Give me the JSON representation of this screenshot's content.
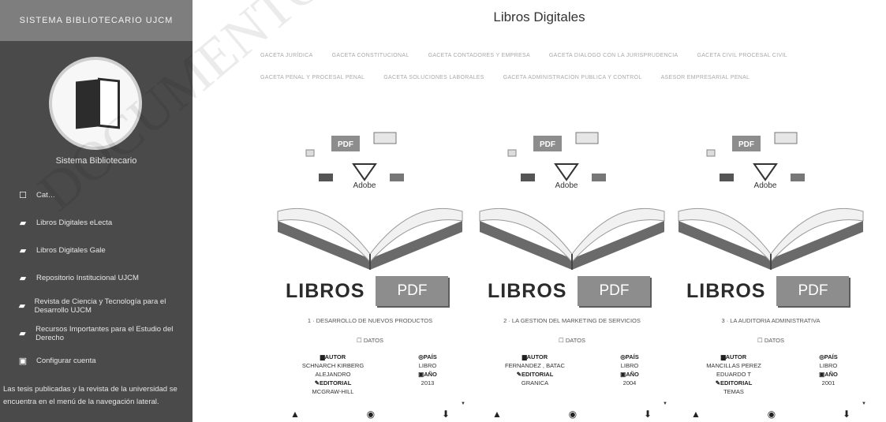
{
  "sidebar": {
    "header": "SISTEMA BIBLIOTECARIO UJCM",
    "user_name": "Sistema Bibliotecario",
    "items": [
      {
        "label": "Cat…",
        "icon": "bookmark-icon"
      },
      {
        "label": "Libros Digitales eLecta",
        "icon": "book-icon"
      },
      {
        "label": "Libros Digitales Gale",
        "icon": "book-icon"
      },
      {
        "label": "Repositorio Institucional UJCM",
        "icon": "book-icon"
      },
      {
        "label": "Revista de Ciencia y Tecnología para el Desarrollo UJCM",
        "icon": "book-icon"
      },
      {
        "label": "Recursos Importantes para el Estudio del Derecho",
        "icon": "book-icon"
      },
      {
        "label": "Configurar cuenta",
        "icon": "settings-icon"
      }
    ],
    "footer": "Las tesis publicadas y la revista de la universidad se encuentra en el menú de la navegación lateral."
  },
  "main": {
    "title": "Libros Digitales",
    "categories_row1": [
      "GACETA JURÍDICA",
      "GACETA CONSTITUCIONAL",
      "GACETA CONTADORES Y EMPRESA",
      "GACETA DIALOGO CON LA JURISPRUDENCIA",
      "GACETA CIVIL PROCESAL CIVIL"
    ],
    "categories_row2": [
      "GACETA PENAL Y PROCESAL PENAL",
      "GACETA SOLUCIONES LABORALES",
      "GACETA ADMINISTRACION PUBLICA Y CONTROL",
      "ASESOR EMPRESARIAL PENAL"
    ],
    "cover_libros": "LIBROS",
    "cover_pdf": "PDF",
    "cover_adobe": "Adobe",
    "datos_label": "DATOS",
    "labels": {
      "autor": "AUTOR",
      "editorial": "EDITORIAL",
      "pais": "PAÍS",
      "anio": "AÑO"
    },
    "books": [
      {
        "title": "1 · DESARROLLO DE NUEVOS PRODUCTOS",
        "autor1": "SCHNARCH KIRBERG",
        "autor2": "ALEJANDRO",
        "editorial": "MCGRAW-HILL",
        "pais": "LIBRO",
        "anio": "2013"
      },
      {
        "title": "2 · LA GESTION DEL MARKETING DE SERVICIOS",
        "autor1": "FERNANDEZ , BATAC",
        "autor2": "",
        "editorial": "GRANICA",
        "pais": "LIBRO",
        "anio": "2004"
      },
      {
        "title": "3 · LA AUDITORIA ADMINISTRATIVA",
        "autor1": "MANCILLAS PEREZ",
        "autor2": "EDUARDO T",
        "editorial": "TEMAS",
        "pais": "LIBRO",
        "anio": "2001"
      }
    ]
  },
  "watermark": "DOCUMENTO",
  "colors": {
    "sidebar": "#4a4a4a",
    "sidebar_header": "#7e7e7e",
    "pdf_badge": "#8d8d8d"
  }
}
